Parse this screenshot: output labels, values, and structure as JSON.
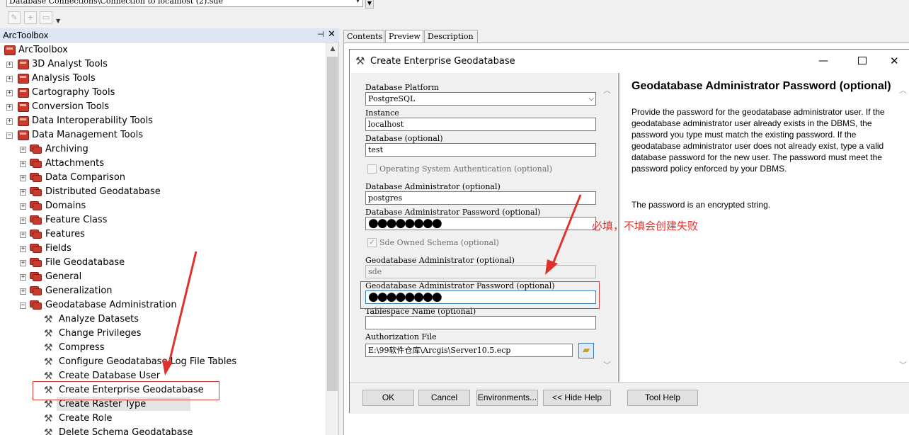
{
  "topbar": {
    "path_value": "Database Connections\\Connection to localhost (2).sde",
    "toolbar_icons": [
      "edit-icon",
      "add-icon",
      "add-folder-icon"
    ]
  },
  "arctoolbox": {
    "title": "ArcToolbox",
    "pin_glyph": "⊣",
    "close_glyph": "✕",
    "root": "ArcToolbox",
    "toolboxes": [
      {
        "label": "3D Analyst Tools",
        "expanded": false
      },
      {
        "label": "Analysis Tools",
        "expanded": false
      },
      {
        "label": "Cartography Tools",
        "expanded": false
      },
      {
        "label": "Conversion Tools",
        "expanded": false
      },
      {
        "label": "Data Interoperability Tools",
        "expanded": false
      },
      {
        "label": "Data Management Tools",
        "expanded": true
      }
    ],
    "toolsets": [
      "Archiving",
      "Attachments",
      "Data Comparison",
      "Distributed Geodatabase",
      "Domains",
      "Feature Class",
      "Features",
      "Fields",
      "File Geodatabase",
      "General",
      "Generalization",
      "Geodatabase Administration"
    ],
    "tools": [
      "Analyze Datasets",
      "Change Privileges",
      "Compress",
      "Configure Geodatabase Log File Tables",
      "Create Database User",
      "Create Enterprise Geodatabase",
      "Create Raster Type",
      "Create Role",
      "Delete Schema Geodatabase"
    ],
    "selected_tool": "Create Enterprise Geodatabase"
  },
  "tabs": [
    {
      "label": "Contents",
      "active": false
    },
    {
      "label": "Preview",
      "active": true
    },
    {
      "label": "Description",
      "active": false
    }
  ],
  "dialog": {
    "title": "Create Enterprise Geodatabase",
    "controls": {
      "minimize": "—",
      "close": "✕"
    },
    "fields": {
      "platform_label": "Database Platform",
      "platform_value": "PostgreSQL",
      "instance_label": "Instance",
      "instance_value": "localhost",
      "database_label": "Database (optional)",
      "database_value": "test",
      "os_auth_label": "Operating System Authentication (optional)",
      "db_admin_label": "Database Administrator (optional)",
      "db_admin_value": "postgres",
      "db_admin_pw_label": "Database Administrator Password (optional)",
      "db_admin_pw_value": "●●●●●●●●",
      "sde_schema_label": "Sde Owned Schema (optional)",
      "gdb_admin_label": "Geodatabase Administrator (optional)",
      "gdb_admin_value": "sde",
      "gdb_admin_pw_label": "Geodatabase Administrator Password (optional)",
      "gdb_admin_pw_value": "●●●●●●●●",
      "tablespace_label": "Tablespace Name (optional)",
      "tablespace_value": "",
      "auth_file_label": "Authorization File",
      "auth_file_value": "E:\\99软件仓库\\Arcgis\\Server10.5.ecp"
    },
    "help": {
      "title": "Geodatabase Administrator Password (optional)",
      "body": "Provide the password for the geodatabase administrator user. If the geodatabase administrator user already exists in the DBMS, the password you type must match the existing password. If the geodatabase administrator user does not already exist, type a valid database password for the new user. The password must meet the password policy enforced by your DBMS.",
      "note": "The password is an encrypted string."
    },
    "buttons": {
      "ok": "OK",
      "cancel": "Cancel",
      "environments": "Environments...",
      "hide_help": "<< Hide Help",
      "tool_help": "Tool Help"
    }
  },
  "annotation": {
    "text": "必填，不填会创建失败",
    "color": "#e0322c"
  }
}
